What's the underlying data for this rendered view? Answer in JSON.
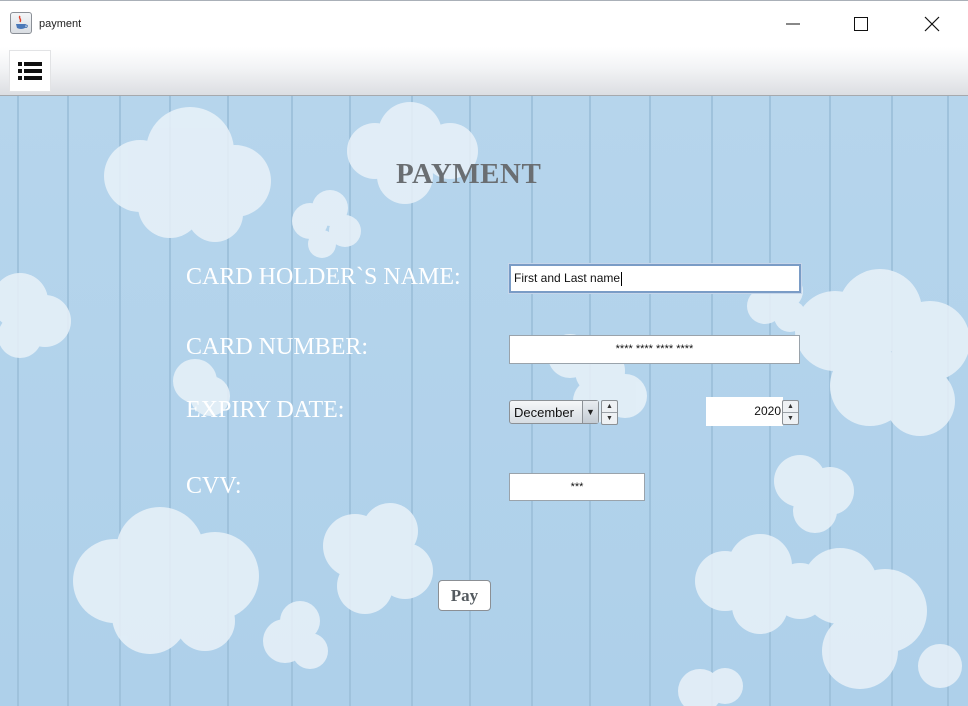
{
  "window": {
    "title": "payment",
    "app_icon": "java-cup-icon",
    "controls": {
      "minimize_icon": "minimize-icon",
      "maximize_icon": "maximize-icon",
      "close_icon": "close-icon"
    }
  },
  "toolbar": {
    "menu_icon": "list-menu-icon"
  },
  "form": {
    "heading": "PAYMENT",
    "name_label": "CARD HOLDER`S NAME:",
    "name_value": "First and Last name",
    "card_label": "CARD NUMBER:",
    "card_value": "**** **** **** ****",
    "expiry_label": "EXPIRY DATE:",
    "expiry_month": "December",
    "expiry_year": "2020",
    "cvv_label": "CVV:",
    "cvv_value": "***",
    "pay_label": "Pay"
  },
  "colors": {
    "background": "#b8d6ec",
    "heading": "#6a6e72",
    "label": "#ffffff",
    "focus_border": "#7a9cc6"
  }
}
